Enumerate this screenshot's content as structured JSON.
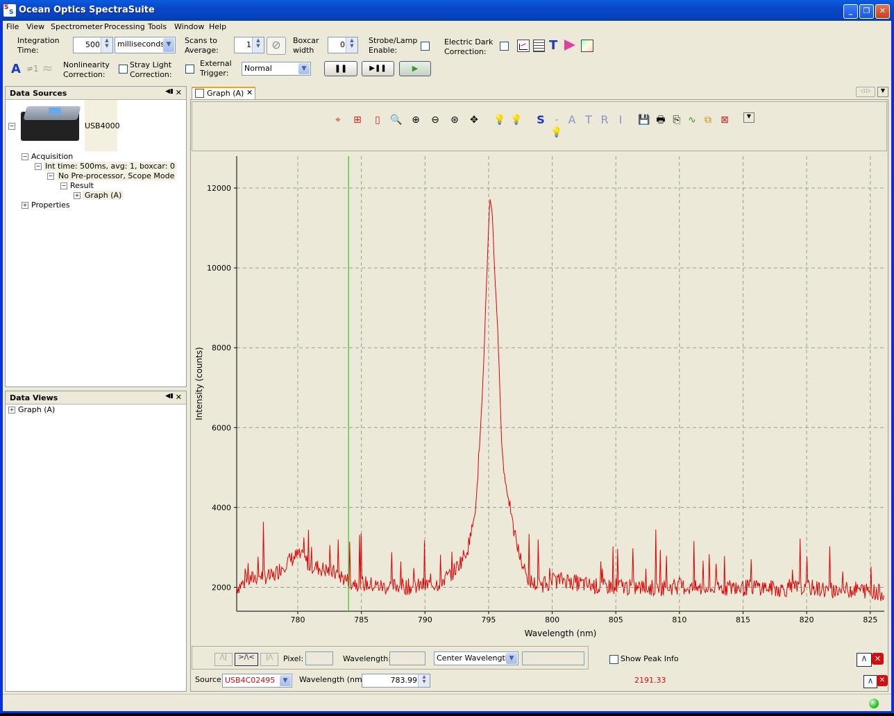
{
  "window": {
    "title": "Ocean Optics SpectraSuite"
  },
  "menu": [
    "File",
    "View",
    "Spectrometer",
    "Processing",
    "Tools",
    "Window",
    "Help"
  ],
  "toolbar": {
    "integration_time_label_1": "Integration",
    "integration_time_label_2": "Time:",
    "integration_time_value": "500",
    "integration_unit": "milliseconds",
    "scans_label_1": "Scans to",
    "scans_label_2": "Average:",
    "scans_value": "1",
    "boxcar_label_1": "Boxcar",
    "boxcar_label_2": "width",
    "boxcar_value": "0",
    "strobe_label_1": "Strobe/Lamp",
    "strobe_label_2": "Enable:",
    "dark_label_1": "Electric Dark",
    "dark_label_2": "Correction:",
    "nonlin_label_1": "Nonlinearity",
    "nonlin_label_2": "Correction:",
    "stray_label_1": "Stray Light",
    "stray_label_2": "Correction:",
    "trigger_label_1": "External",
    "trigger_label_2": "Trigger:",
    "trigger_value": "Normal",
    "glyph_a": "A",
    "glyph_ne1": "≠1",
    "glyph_wave": "≈"
  },
  "data_sources": {
    "title": "Data Sources",
    "device": "USB4000",
    "acquisition": "Acquisition",
    "int_time": "Int time: 500ms, avg: 1, boxcar: 0",
    "preprocessor": "No Pre-processor, Scope Mode",
    "result": "Result",
    "graph": "Graph (A)",
    "properties": "Properties"
  },
  "data_views": {
    "title": "Data Views",
    "graph": "Graph (A)"
  },
  "editor": {
    "tab_label": "Graph (A)",
    "letters": [
      "S",
      "A",
      "T",
      "R",
      "I"
    ]
  },
  "bottom": {
    "pixel_label": "Pixel:",
    "wavelength_label": "Wavelength:",
    "center_wavelength": "Center Wavelength",
    "show_peak_info": "Show Peak Info",
    "source_label": "Source:",
    "source_value": "USB4C02495",
    "wavelength_nm_label": "Wavelength (nm):",
    "wavelength_nm_value": "783.99",
    "cursor_intensity": "2191.33"
  },
  "colors": {
    "accent": "#0831d9",
    "series": "#e00000",
    "cursor": "#22cc22",
    "highlight": "#f4f0e0"
  },
  "chart_data": {
    "type": "line",
    "xlabel": "Wavelength (nm)",
    "ylabel": "Intensity (counts)",
    "xlim": [
      775.2,
      826.1
    ],
    "ylim": [
      1400,
      12800
    ],
    "xticks": [
      780,
      785,
      790,
      795,
      800,
      805,
      810,
      815,
      820,
      825
    ],
    "yticks": [
      2000,
      4000,
      6000,
      8000,
      10000,
      12000
    ],
    "grid": true,
    "cursor_x": 783.99,
    "series": [
      {
        "color": "#e00000",
        "x": [
          775.2,
          776,
          777,
          778,
          779,
          780,
          780.5,
          781,
          782,
          783,
          784,
          785,
          786,
          787,
          788,
          789,
          790,
          791,
          792,
          792.5,
          793,
          793.5,
          794,
          794.3,
          794.6,
          794.8,
          795,
          795.1,
          795.3,
          795.5,
          795.8,
          796,
          796.2,
          796.5,
          796.8,
          797,
          797.5,
          798,
          798.5,
          799,
          800,
          801,
          802,
          803,
          804,
          805,
          806,
          808,
          810,
          812,
          814,
          815,
          816,
          818,
          820,
          822,
          824,
          825,
          826.1
        ],
        "y": [
          2000,
          2150,
          2300,
          2250,
          2600,
          2800,
          2700,
          2550,
          2450,
          2350,
          2150,
          2100,
          2050,
          2000,
          2050,
          2000,
          2050,
          2100,
          2300,
          2500,
          2750,
          3100,
          4000,
          5500,
          7500,
          9300,
          11000,
          11800,
          11300,
          9800,
          7800,
          5800,
          4900,
          4300,
          3800,
          3400,
          2700,
          2250,
          2100,
          2050,
          2150,
          2200,
          2100,
          2050,
          2000,
          2050,
          2000,
          1980,
          2020,
          1950,
          2000,
          1980,
          2020,
          1950,
          2000,
          1920,
          1950,
          1900,
          1850
        ]
      }
    ]
  }
}
